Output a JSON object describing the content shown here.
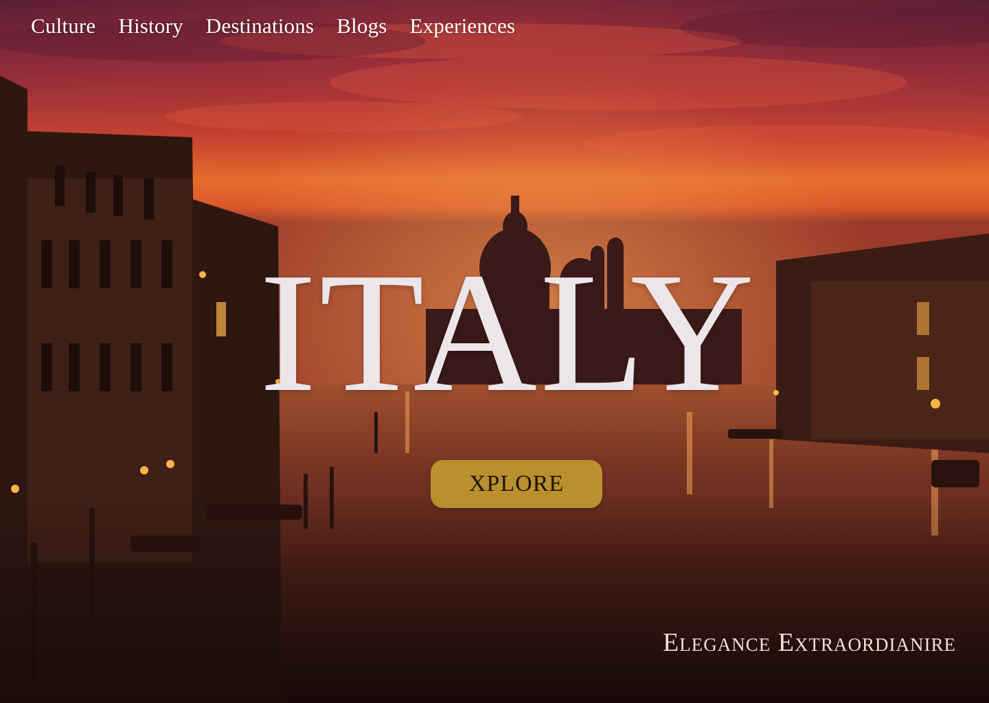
{
  "nav": {
    "items": [
      {
        "label": "Culture"
      },
      {
        "label": "History"
      },
      {
        "label": "Destinations"
      },
      {
        "label": "Blogs"
      },
      {
        "label": "Experiences"
      }
    ]
  },
  "hero": {
    "title": "ITALY",
    "button_label": "XPLORE",
    "tagline": "Elegance Extraordianire"
  },
  "colors": {
    "button_bg": "#b9902d",
    "title_text": "#ece6ea",
    "sky_top": "#5a1f3a",
    "sunset_orange": "#e0642a"
  }
}
